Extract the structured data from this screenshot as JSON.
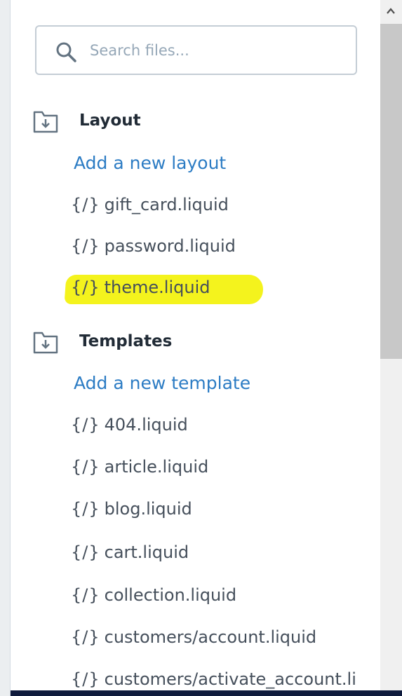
{
  "search": {
    "placeholder": "Search files..."
  },
  "sections": {
    "layout": {
      "title": "Layout",
      "add_label": "Add a new layout"
    },
    "templates": {
      "title": "Templates",
      "add_label": "Add a new template"
    }
  },
  "files": {
    "braces": "{/}",
    "layout": [
      "gift_card.liquid",
      "password.liquid",
      "theme.liquid"
    ],
    "templates": [
      "404.liquid",
      "article.liquid",
      "blog.liquid",
      "cart.liquid",
      "collection.liquid",
      "customers/account.liquid",
      "customers/activate_account.li"
    ]
  },
  "highlighted_file": "theme.liquid",
  "colors": {
    "link": "#2c7cc4",
    "highlight": "#f4f31d",
    "text": "#454f5b",
    "heading": "#212b36"
  },
  "icons": {
    "search": "search-icon",
    "folder": "folder-download-icon",
    "scroll_up": "chevron-up-icon"
  }
}
